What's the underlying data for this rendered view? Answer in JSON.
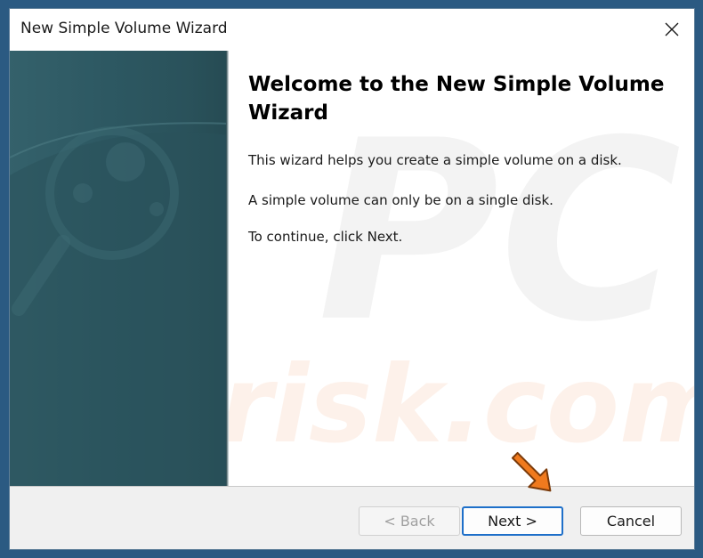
{
  "window": {
    "title": "New Simple Volume Wizard"
  },
  "titlebar": {
    "close_icon": "close-icon"
  },
  "main": {
    "heading": "Welcome to the New Simple Volume Wizard",
    "paragraphs": [
      "This wizard helps you create a simple volume on a disk.",
      "A simple volume can only be on a single disk.",
      "To continue, click Next."
    ]
  },
  "footer": {
    "back_label": "< Back",
    "next_label": "Next >",
    "cancel_label": "Cancel",
    "back_enabled": false
  },
  "watermark": {
    "line1": "PC",
    "line2": "risk.com"
  },
  "colors": {
    "desktop": "#2b5a82",
    "side_panel": "#2d5862",
    "accent": "#1e6fc9",
    "arrow": "#f07a1e"
  }
}
